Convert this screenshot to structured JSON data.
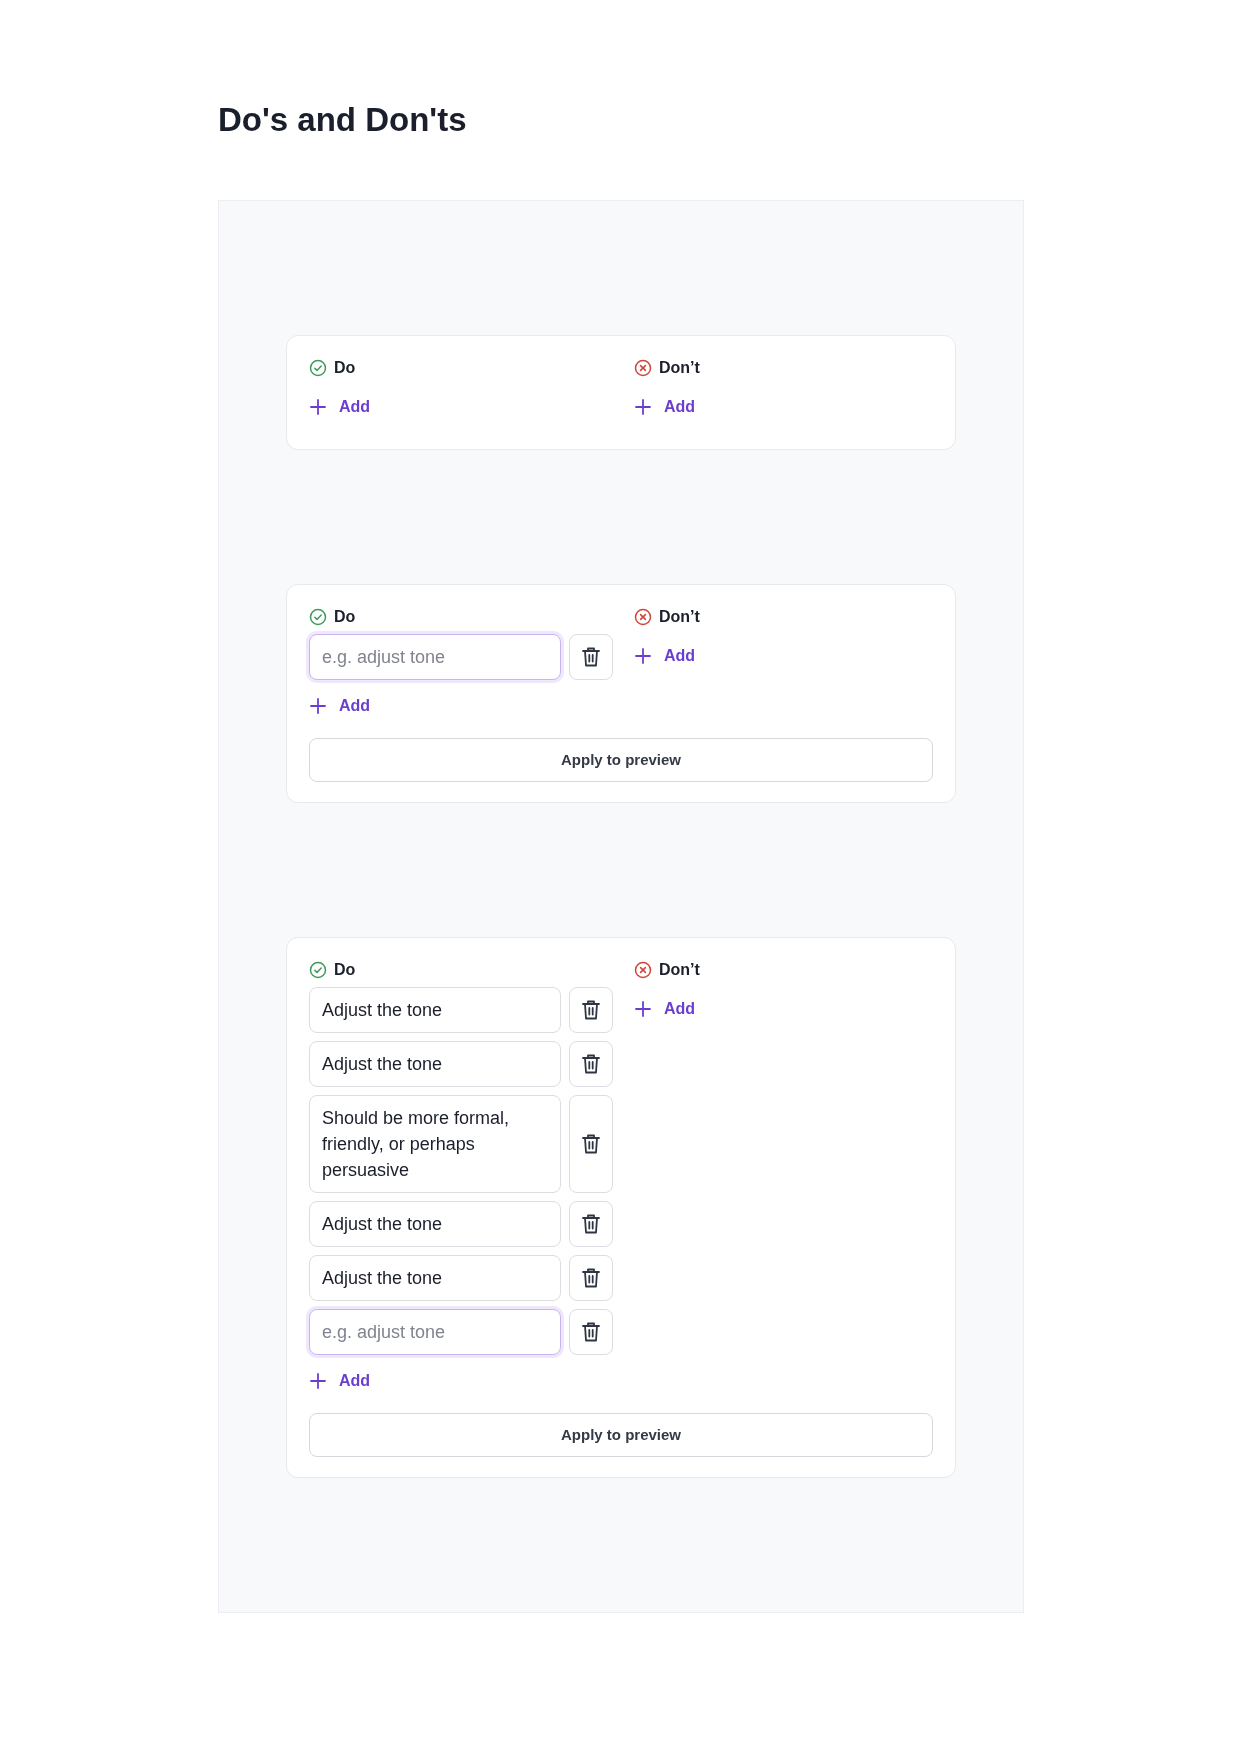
{
  "title": "Do's and Don'ts",
  "cards": [
    {
      "columns": [
        {
          "kind": "do",
          "label": "Do",
          "add_label": "Add"
        },
        {
          "kind": "dont",
          "label": "Don’t",
          "add_label": "Add"
        }
      ]
    },
    {
      "columns": [
        {
          "kind": "do",
          "label": "Do",
          "entries": [
            {
              "placeholder": "e.g. adjust tone",
              "focused": true
            }
          ],
          "add_label": "Add"
        },
        {
          "kind": "dont",
          "label": "Don’t",
          "add_label": "Add"
        }
      ],
      "apply_button": "Apply to preview"
    },
    {
      "columns": [
        {
          "kind": "do",
          "label": "Do",
          "entries": [
            {
              "value": "Adjust the tone",
              "focused": false
            },
            {
              "value": "Adjust the tone",
              "focused": false
            },
            {
              "value": "Should be more formal, friendly, or perhaps persuasive",
              "focused": false
            },
            {
              "value": "Adjust the tone",
              "focused": false
            },
            {
              "value": "Adjust the tone",
              "focused": false
            },
            {
              "placeholder": "e.g. adjust tone",
              "focused": true
            }
          ],
          "add_label": "Add"
        },
        {
          "kind": "dont",
          "label": "Don’t",
          "add_label": "Add"
        }
      ],
      "apply_button": "Apply to preview"
    }
  ]
}
